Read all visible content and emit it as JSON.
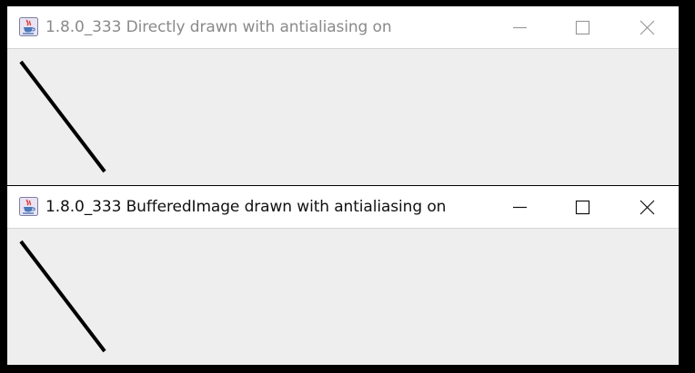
{
  "windows": [
    {
      "title": "1.8.0_333 Directly drawn with antialiasing on",
      "state": "inactive",
      "icon": "java-cup-icon",
      "controls": {
        "minimize": "minimize-icon",
        "maximize": "maximize-icon",
        "close": "close-icon"
      }
    },
    {
      "title": "1.8.0_333 BufferedImage drawn with antialiasing on",
      "state": "active",
      "icon": "java-cup-icon",
      "controls": {
        "minimize": "minimize-icon",
        "maximize": "maximize-icon",
        "close": "close-icon"
      }
    }
  ],
  "colors": {
    "screen_background": "#000000",
    "titlebar_background": "#ffffff",
    "client_background": "#eeeeee",
    "title_inactive": "#8a8a8a",
    "title_active": "#111111",
    "drawn_line": "#000000"
  }
}
